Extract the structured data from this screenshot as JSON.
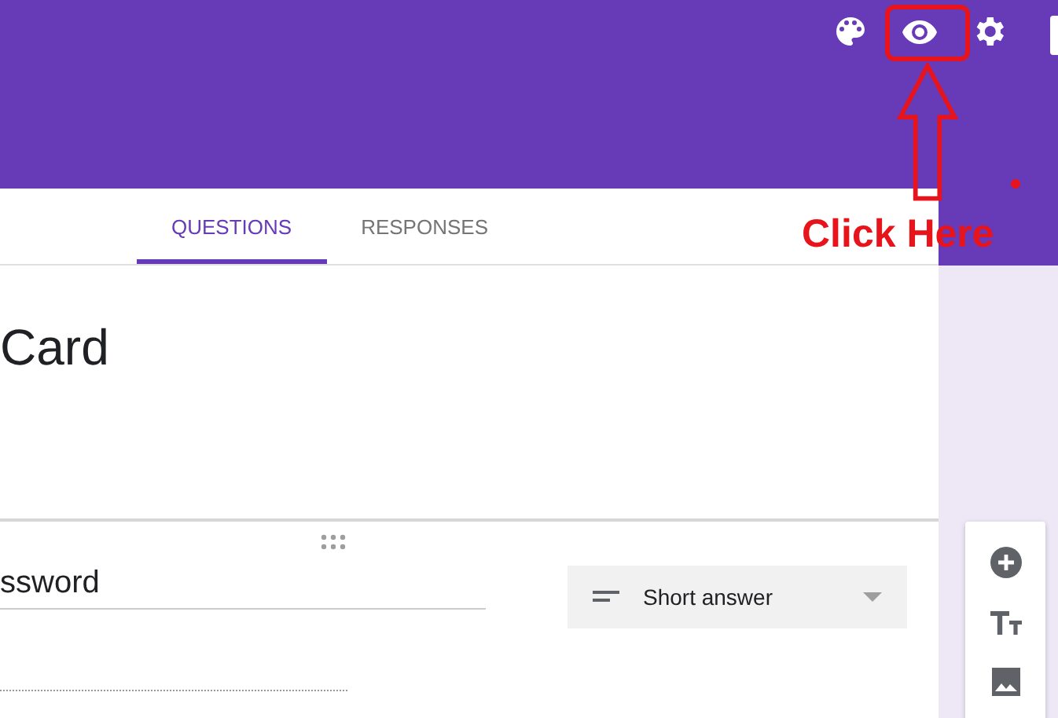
{
  "header": {
    "actions": [
      {
        "kind": "palette"
      },
      {
        "kind": "preview"
      },
      {
        "kind": "settings"
      }
    ]
  },
  "tabs": [
    {
      "label": "QUESTIONS",
      "selected": true
    },
    {
      "label": "RESPONSES",
      "selected": false
    }
  ],
  "form_title": "Card",
  "question": {
    "title": "ssword",
    "type": "Short answer"
  },
  "toolbar": [
    {
      "kind": "add"
    },
    {
      "kind": "text"
    },
    {
      "kind": "image"
    }
  ],
  "annotation": {
    "label": "Click Here"
  }
}
